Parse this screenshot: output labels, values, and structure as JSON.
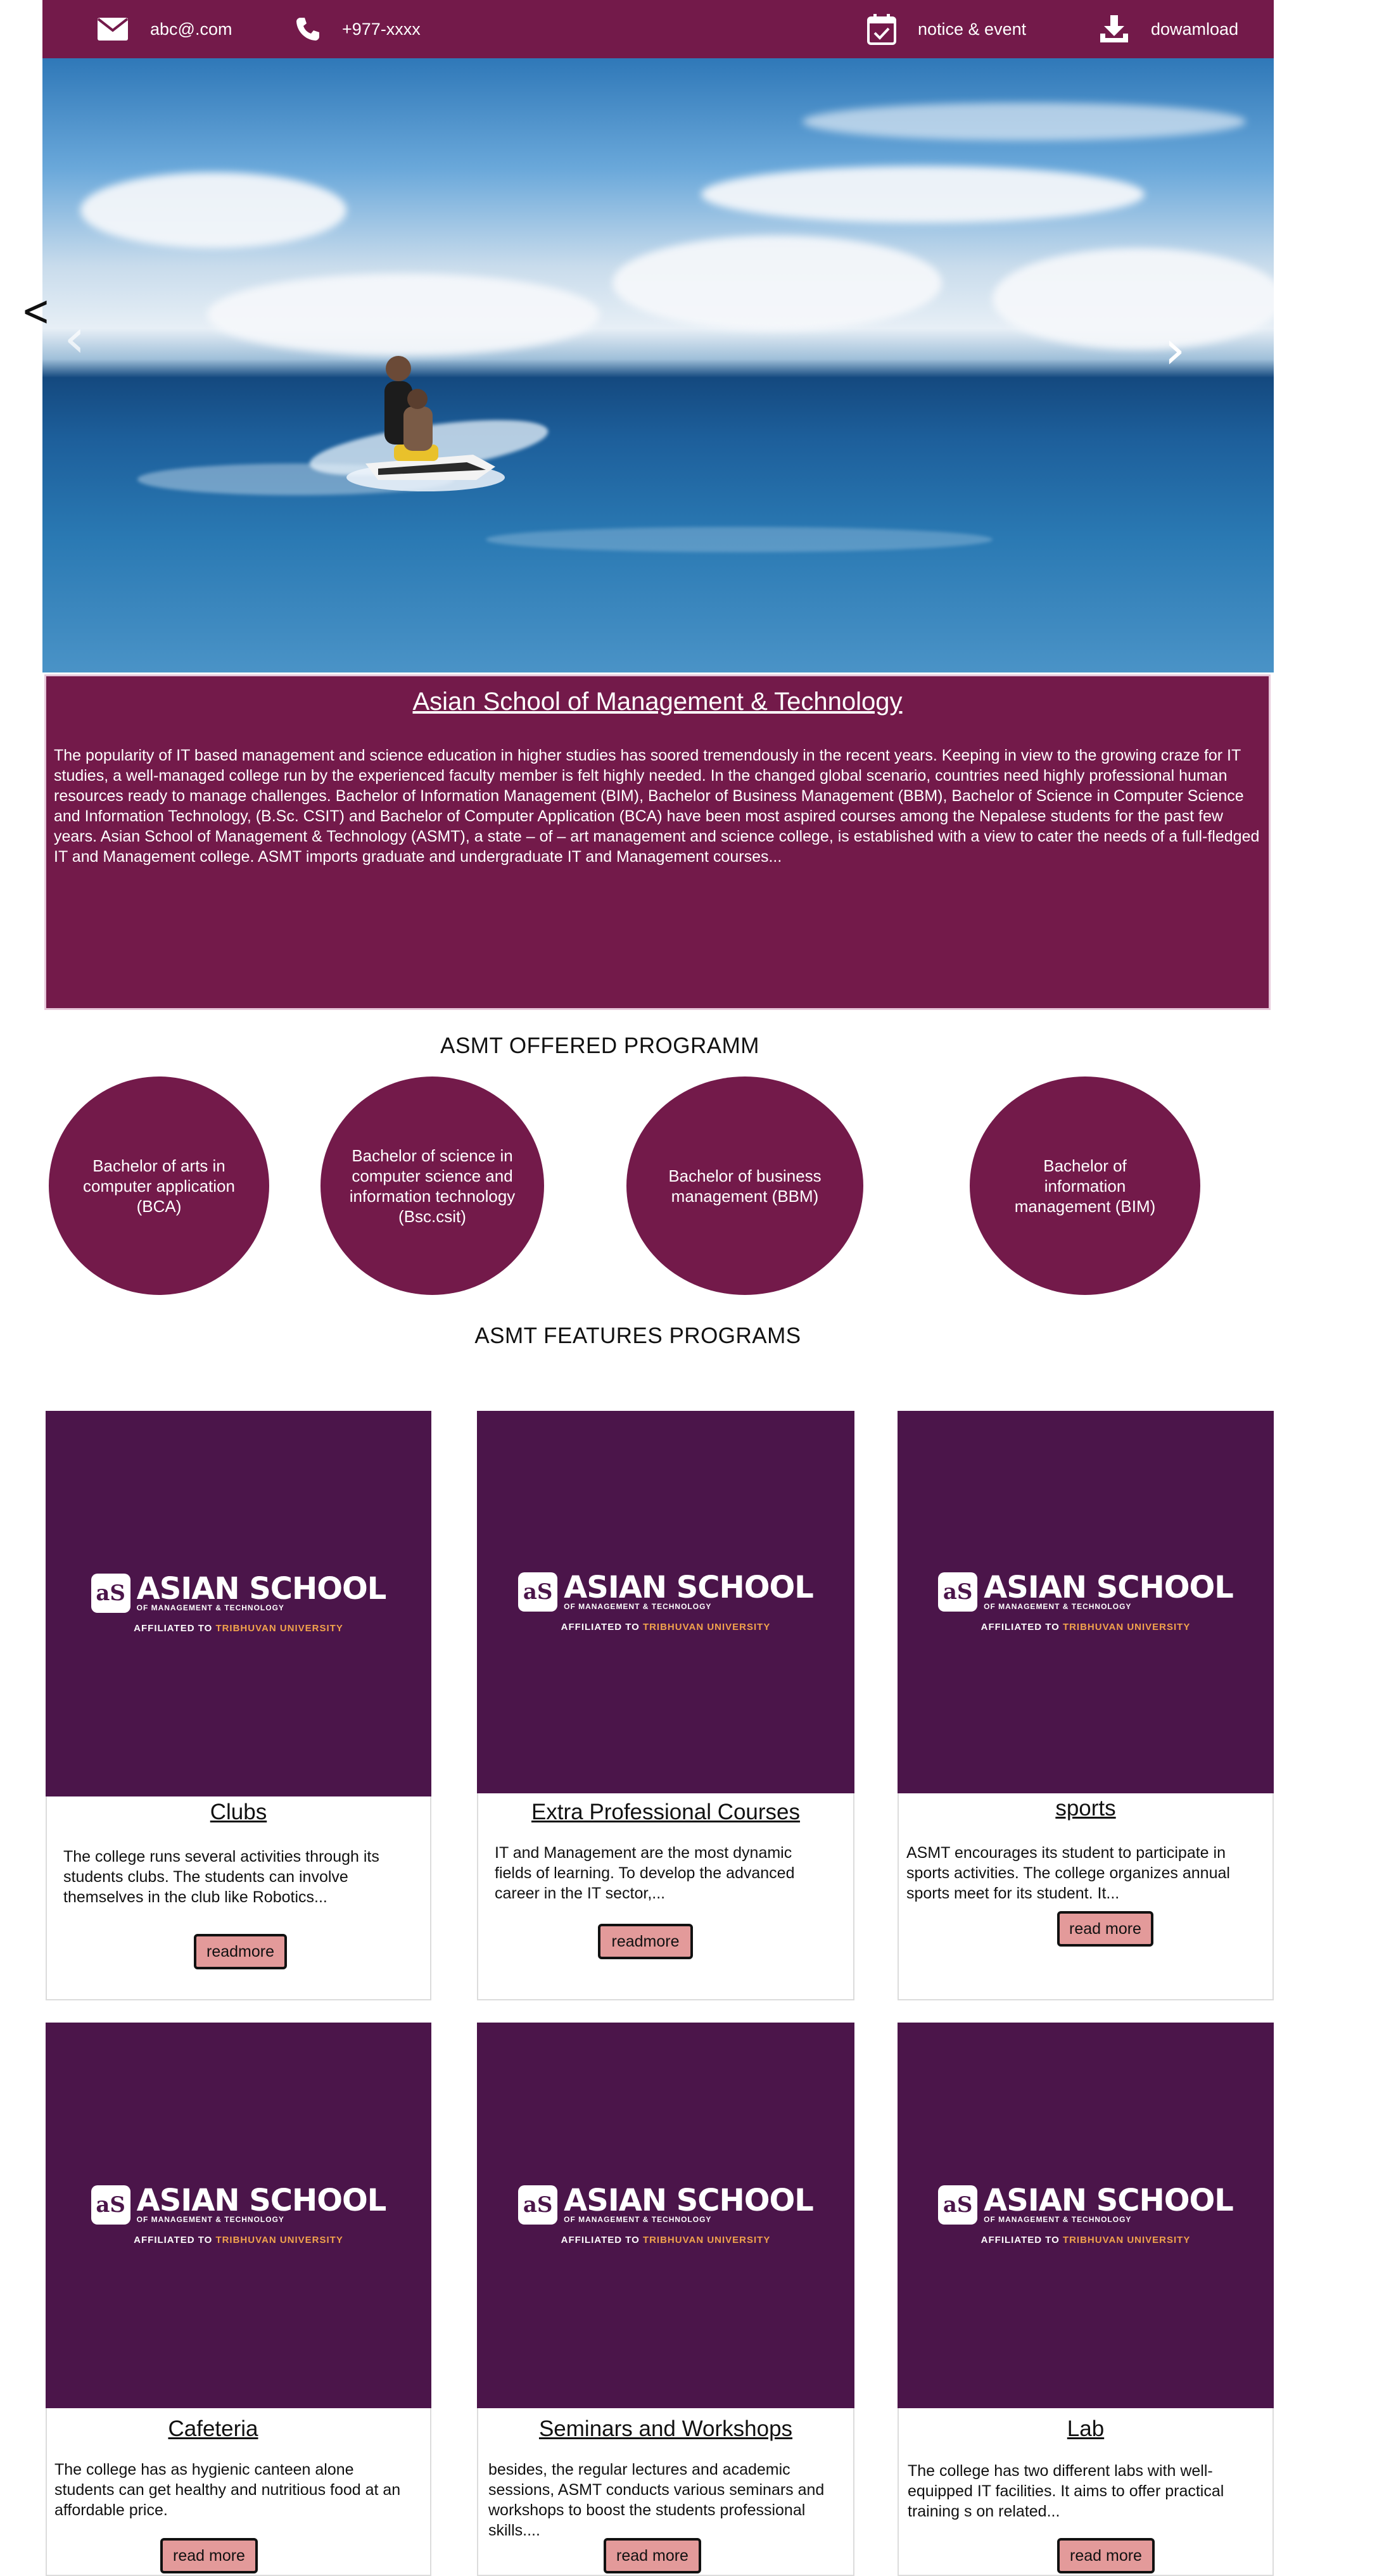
{
  "topbar": {
    "email": "abc@.com",
    "phone": "+977-xxxx",
    "notice": "notice & event",
    "download": "dowamload"
  },
  "hero": {
    "prev_glyph": "‹",
    "next_glyph": "›",
    "outer_prev_glyph": "<"
  },
  "about": {
    "title": "Asian School of Management & Technology",
    "text": "The popularity of IT based management and science education in higher studies has soored tremendously in the recent years. Keeping in view to the growing craze for IT studies, a well-managed college run by the experienced faculty member is felt highly needed. In the changed global scenario, countries need highly professional human resources ready to manage challenges. Bachelor of Information Management (BIM), Bachelor of Business Management (BBM), Bachelor of Science in Computer Science and Information Technology, (B.Sc. CSIT) and Bachelor of Computer Application (BCA) have been most aspired courses among the Nepalese students for the past few years. Asian School of Management & Technology (ASMT), a state – of – art management and science college, is established with a view to cater the needs of a full-fledged IT and Management college. ASMT imports graduate and undergraduate IT and Management courses..."
  },
  "programs": {
    "heading": "ASMT OFFERED PROGRAMM",
    "items": [
      "Bachelor of arts in computer application (BCA)",
      "Bachelor of science in computer science and information technology (Bsc.csit)",
      "Bachelor of business management (BBM)",
      "Bachelor of information management (BIM)"
    ]
  },
  "features": {
    "heading": "ASMT FEATURES PROGRAMS",
    "logo": {
      "mark": "aS",
      "name": "ASIAN SCHOOL",
      "sub": "OF MANAGEMENT & TECHNOLOGY",
      "aff_prefix": "AFFILIATED TO",
      "aff_university": "TRIBHUVAN UNIVERSITY"
    },
    "cards": [
      {
        "title": "Clubs",
        "desc": "The college runs several activities through its students clubs. The students can involve themselves in the club like Robotics...",
        "button": "readmore"
      },
      {
        "title": "Extra Professional Courses",
        "desc": "IT and Management are the most dynamic fields of learning. To develop the advanced career in the IT sector,...",
        "button": "readmore"
      },
      {
        "title": "sports",
        "desc": "ASMT encourages its student to participate in sports activities. The college organizes annual sports meet for its student. It...",
        "button": "read more"
      },
      {
        "title": "Cafeteria",
        "desc": "The college has as hygienic canteen alone students can get healthy and nutritious food at an affordable price.",
        "button": "read more"
      },
      {
        "title": "Seminars and Workshops",
        "desc": "besides, the regular lectures and academic sessions, ASMT conducts various seminars and workshops to boost the students professional skills....",
        "button": "read more"
      },
      {
        "title": "Lab",
        "desc": "The college has two different labs with well-equipped IT facilities. It aims to offer practical training s on related...",
        "button": "read more"
      }
    ]
  }
}
